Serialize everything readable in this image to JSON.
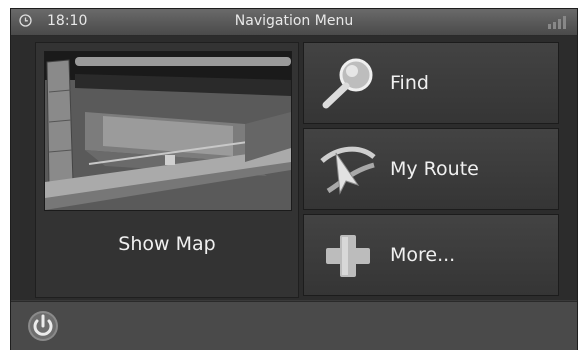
{
  "status_bar": {
    "time": "18:10",
    "title": "Navigation Menu",
    "clock_icon": "clock-icon",
    "signal_icon": "signal-strength-icon"
  },
  "map_tile": {
    "label": "Show Map",
    "preview": "3d-map-preview"
  },
  "menu": {
    "items": [
      {
        "label": "Find",
        "icon": "magnifier-icon"
      },
      {
        "label": "My Route",
        "icon": "route-icon"
      },
      {
        "label": "More...",
        "icon": "plus-icon"
      }
    ]
  },
  "bottom_bar": {
    "power_icon": "power-icon"
  }
}
